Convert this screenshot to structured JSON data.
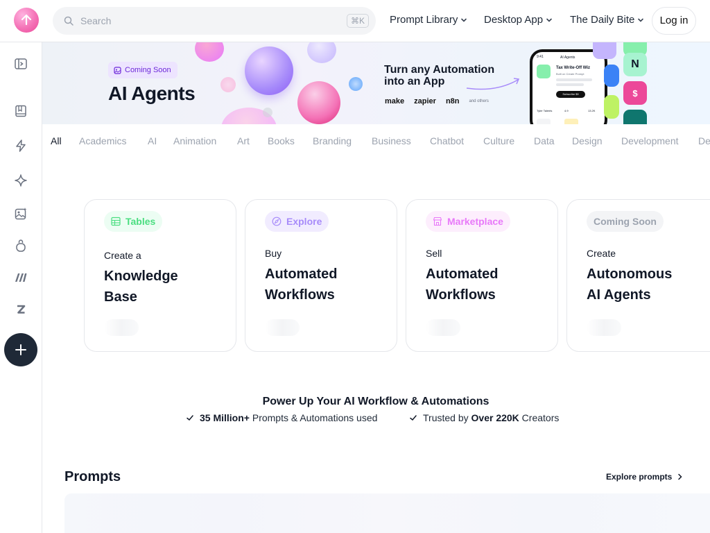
{
  "header": {
    "search": {
      "placeholder": "Search",
      "shortcut": "⌘K"
    },
    "nav": [
      {
        "label": "Prompt Library"
      },
      {
        "label": "Desktop App"
      },
      {
        "label": "The Daily Bite"
      }
    ],
    "login_label": "Log in"
  },
  "sidebar": {
    "items": [
      {
        "icon": "sidebar-toggle-icon"
      },
      {
        "icon": "book-icon"
      },
      {
        "icon": "lightning-icon"
      },
      {
        "icon": "sparkle-icon"
      },
      {
        "icon": "image-sparkle-icon"
      },
      {
        "icon": "bag-icon"
      },
      {
        "icon": "make-logo-icon"
      },
      {
        "icon": "zapier-logo-icon"
      }
    ],
    "add_icon": "plus-icon"
  },
  "banner": {
    "badge": "Coming Soon",
    "title": "AI Agents",
    "headline_line1": "Turn any Automation",
    "headline_line2": "into an App",
    "brands": [
      "make",
      "zapier",
      "n8n",
      "and others"
    ],
    "phone": {
      "time": "9:41",
      "app_title": "AI Agents",
      "card_title": "Tax Write-Off Wiz",
      "card_sub": "Built on Create Prompt",
      "cta": "Subscribe $9",
      "author": "Tyler Talents",
      "rating": "4.9",
      "count": "13.2K"
    }
  },
  "categories": [
    "All",
    "Academics",
    "AI",
    "Animation",
    "Art",
    "Books",
    "Branding",
    "Business",
    "Chatbot",
    "Culture",
    "Data",
    "Design",
    "Development",
    "De"
  ],
  "cards": [
    {
      "pill": "Tables",
      "pill_color": "#22c55e",
      "pill_bg": "#ecfdf3",
      "sub": "Create a",
      "big1": "Knowledge",
      "big2": "Base"
    },
    {
      "pill": "Explore",
      "pill_color": "#8b5cf6",
      "pill_bg": "#f1ecff",
      "sub": "Buy",
      "big1": "Automated",
      "big2": "Workflows"
    },
    {
      "pill": "Marketplace",
      "pill_color": "#e879f9",
      "pill_bg": "#fdeefd",
      "sub": "Sell",
      "big1": "Automated",
      "big2": "Workflows"
    },
    {
      "pill": "Coming Soon",
      "pill_color": "#9ca3af",
      "pill_bg": "#f3f4f6",
      "sub": "Create",
      "big1": "Autonomous",
      "big2": "AI Agents"
    }
  ],
  "power": {
    "title": "Power Up Your AI Workflow & Automations",
    "stat1_bold": "35 Million+",
    "stat1_rest": " Prompts & Automations used",
    "stat2_pre": "Trusted by ",
    "stat2_bold": "Over 220K",
    "stat2_rest": " Creators"
  },
  "prompts": {
    "title": "Prompts",
    "explore_label": "Explore prompts"
  }
}
